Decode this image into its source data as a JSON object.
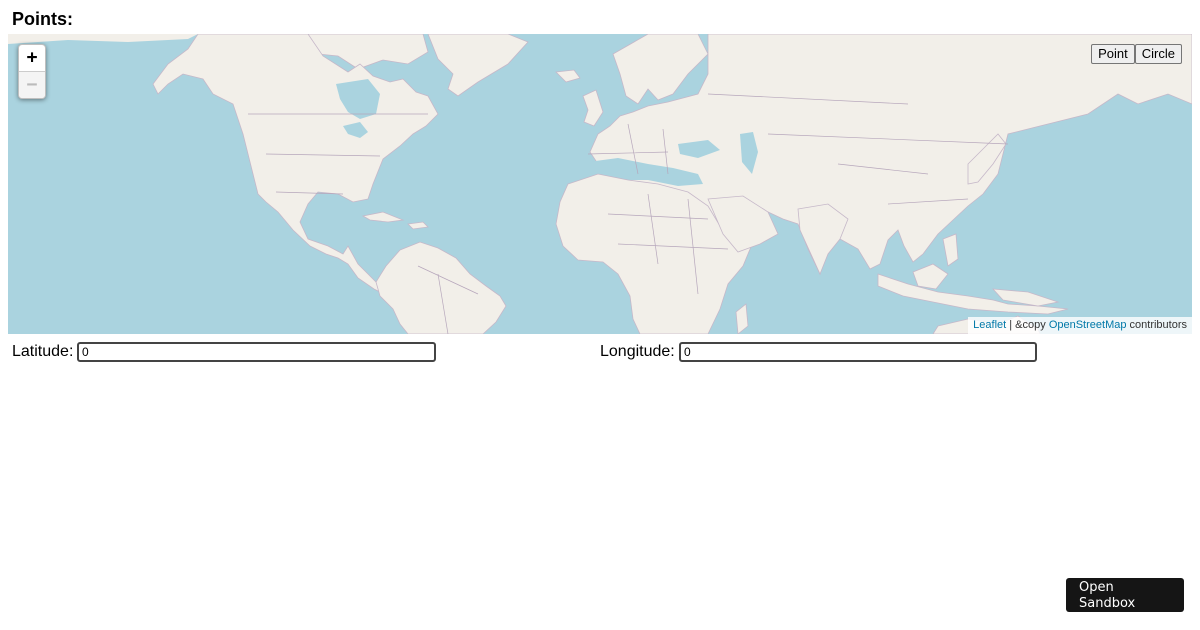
{
  "page": {
    "heading": "Points:"
  },
  "map": {
    "zoom_in_label": "+",
    "zoom_out_label": "−",
    "draw_buttons": {
      "point": "Point",
      "circle": "Circle"
    },
    "attribution": {
      "leaflet": "Leaflet",
      "separator": " | &copy ",
      "osm": "OpenStreetMap",
      "suffix": " contributors"
    },
    "colors": {
      "water": "#aad3df",
      "land": "#f2efe9",
      "border": "#c6b8c9"
    }
  },
  "fields": {
    "latitude": {
      "label": "Latitude:",
      "value": "0"
    },
    "longitude": {
      "label": "Longitude:",
      "value": "0"
    }
  },
  "sandbox_button": {
    "label": "Open Sandbox"
  }
}
